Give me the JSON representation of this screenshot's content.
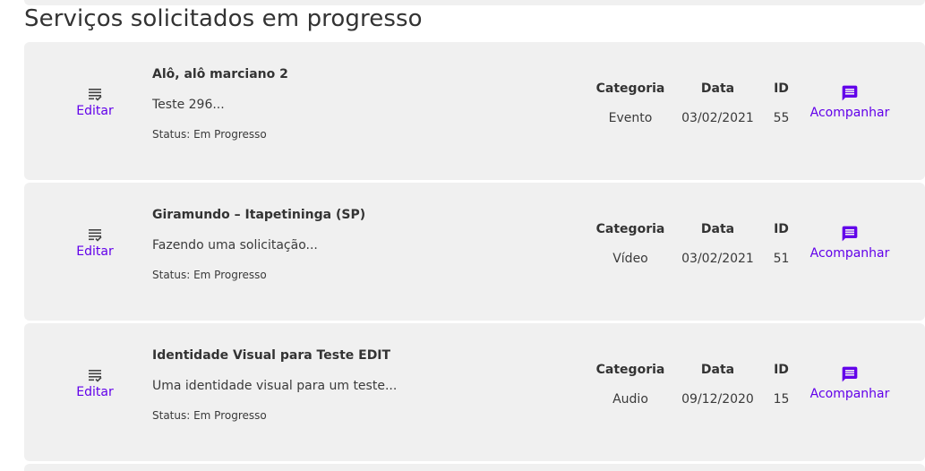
{
  "section": {
    "title": "Serviços solicitados em progresso"
  },
  "colors": {
    "accent": "#6200ea",
    "card_bg": "#f0f0f0"
  },
  "labels": {
    "edit": "Editar",
    "follow": "Acompanhar",
    "category_header": "Categoria",
    "date_header": "Data",
    "id_header": "ID",
    "edit_icon": "list-edit-icon",
    "follow_icon": "chat-message-icon"
  },
  "services": [
    {
      "title": "Alô, alô marciano 2",
      "description": "Teste 296...",
      "status": "Status: Em Progresso",
      "category": "Evento",
      "date": "03/02/2021",
      "id": "55"
    },
    {
      "title": "Giramundo – Itapetininga (SP)",
      "description": "Fazendo uma solicitação...",
      "status": "Status: Em Progresso",
      "category": "Vídeo",
      "date": "03/02/2021",
      "id": "51"
    },
    {
      "title": "Identidade Visual para Teste EDIT",
      "description": "Uma identidade visual para um teste...",
      "status": "Status: Em Progresso",
      "category": "Audio",
      "date": "09/12/2020",
      "id": "15"
    }
  ]
}
